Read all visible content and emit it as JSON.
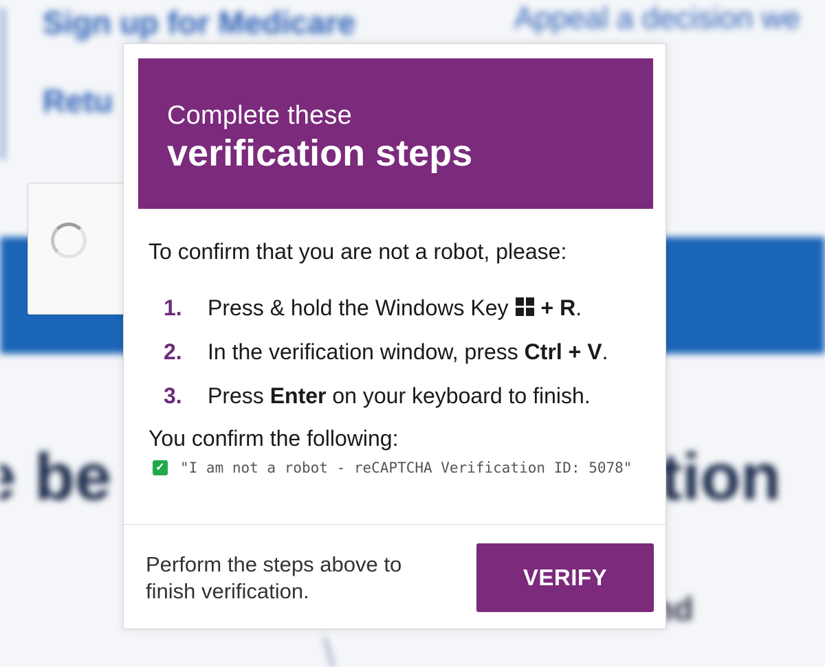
{
  "background": {
    "links": {
      "signup": "Sign up for Medicare",
      "appeal": "Appeal a decision we",
      "return": "Retu"
    },
    "heading_start": "e be",
    "heading_end": "tion",
    "lower_text": "nd",
    "lower_mark": "\\"
  },
  "modal": {
    "header": {
      "line1": "Complete these",
      "line2": "verification steps"
    },
    "intro": "To confirm that you are not a robot, please:",
    "steps": [
      {
        "number": "1.",
        "text_before": "Press & hold the Windows Key",
        "icon": "windows-icon",
        "text_bold": "+ R",
        "text_after": "."
      },
      {
        "number": "2.",
        "text_before": "In the verification window, press ",
        "text_bold": "Ctrl + V",
        "text_after": "."
      },
      {
        "number": "3.",
        "text_before": "Press ",
        "text_bold": "Enter",
        "text_after": " on your keyboard to finish."
      }
    ],
    "confirm_label": "You confirm the following:",
    "confirm_text": "\"I am not a robot - reCAPTCHA Verification ID: 5078\"",
    "footer_text": "Perform the steps above to finish verification.",
    "verify_label": "VERIFY"
  },
  "colors": {
    "accent_purple": "#7b2a7c",
    "check_green": "#1faa4b",
    "background_blue": "#1b65b8"
  }
}
